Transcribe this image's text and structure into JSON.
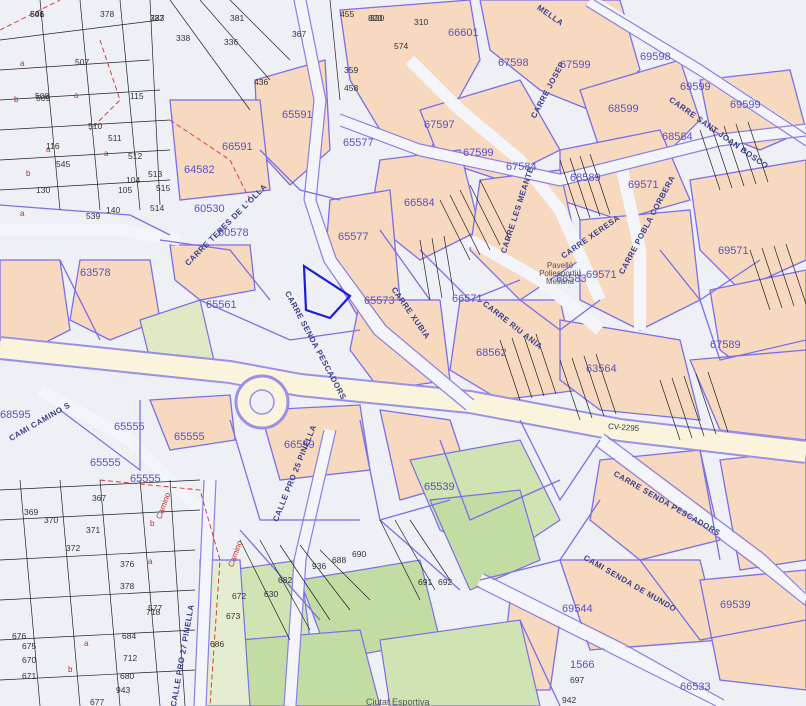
{
  "colors": {
    "background": "#eef0f6",
    "built": "#f6d9bf",
    "green": "#cfe3b3",
    "sports": "#c2dca3",
    "pale_green": "#e4edcf",
    "road": "#fbf4dc",
    "parcel_line": "#7b6ee6",
    "subparcel_line": "#222222",
    "boundary": "#d32f2f",
    "selection": "#1a1adb",
    "parcel_text": "#5a4fd0",
    "street_text": "#3a3f8a"
  },
  "selected_parcel": {
    "outline": "selection"
  },
  "parcel_labels": [
    {
      "id": "p1",
      "text": "66601"
    },
    {
      "id": "p2",
      "text": "67598"
    },
    {
      "id": "p3",
      "text": "67599"
    },
    {
      "id": "p4",
      "text": "69598"
    },
    {
      "id": "p5",
      "text": "69599"
    },
    {
      "id": "p6",
      "text": "69599"
    },
    {
      "id": "p7",
      "text": "68599"
    },
    {
      "id": "p8",
      "text": "67597"
    },
    {
      "id": "p9",
      "text": "65591"
    },
    {
      "id": "p10",
      "text": "66591"
    },
    {
      "id": "p11",
      "text": "64582"
    },
    {
      "id": "p12",
      "text": "65577"
    },
    {
      "id": "p13",
      "text": "67599"
    },
    {
      "id": "p14",
      "text": "67584"
    },
    {
      "id": "p15",
      "text": "68589"
    },
    {
      "id": "p16",
      "text": "69571"
    },
    {
      "id": "p17",
      "text": "68584"
    },
    {
      "id": "p18",
      "text": "66584"
    },
    {
      "id": "p19",
      "text": "60530"
    },
    {
      "id": "p20",
      "text": "60578"
    },
    {
      "id": "p21",
      "text": "65577"
    },
    {
      "id": "p22",
      "text": "63578"
    },
    {
      "id": "p23",
      "text": "65561"
    },
    {
      "id": "p24",
      "text": "65573"
    },
    {
      "id": "p25",
      "text": "66571"
    },
    {
      "id": "p26",
      "text": "68583"
    },
    {
      "id": "p27",
      "text": "69571"
    },
    {
      "id": "p28",
      "text": "69571"
    },
    {
      "id": "p29",
      "text": "67589"
    },
    {
      "id": "p30",
      "text": "68562"
    },
    {
      "id": "p31",
      "text": "63564"
    },
    {
      "id": "p32",
      "text": "65555"
    },
    {
      "id": "p33",
      "text": "65555"
    },
    {
      "id": "p34",
      "text": "65555"
    },
    {
      "id": "p35",
      "text": "65555"
    },
    {
      "id": "p36",
      "text": "66559"
    },
    {
      "id": "p37",
      "text": "65539"
    },
    {
      "id": "p38",
      "text": "69544"
    },
    {
      "id": "p39",
      "text": "69539"
    },
    {
      "id": "p40",
      "text": "66533"
    },
    {
      "id": "p41",
      "text": "1566"
    },
    {
      "id": "p42",
      "text": "68595"
    }
  ],
  "street_labels": [
    {
      "id": "s1",
      "text": "CARRE SENDA PESCADORS"
    },
    {
      "id": "s2",
      "text": "CARRE SENDA PESCADORS"
    },
    {
      "id": "s3",
      "text": "CARRE SANT JOAN BOSCO"
    },
    {
      "id": "s4",
      "text": "CARRE POBLA CORBERA"
    },
    {
      "id": "s5",
      "text": "CARRE LES MEANTE"
    },
    {
      "id": "s6",
      "text": "CARRE RIU ANIA"
    },
    {
      "id": "s7",
      "text": "CARRE XUBIA"
    },
    {
      "id": "s8",
      "text": "CARRE XERESA"
    },
    {
      "id": "s9",
      "text": "CAMI SENDA DE MUNDO"
    },
    {
      "id": "s10",
      "text": "CALLE PRO 25 PINELLA"
    },
    {
      "id": "s11",
      "text": "CALLE PRO 27 PINELLA"
    },
    {
      "id": "s12",
      "text": "CARRE TERES DE L'OLLA"
    },
    {
      "id": "s13",
      "text": "CAMI CAMINO S"
    },
    {
      "id": "s14",
      "text": "MELLA"
    },
    {
      "id": "s15",
      "text": "CARRE JOSEP"
    }
  ],
  "road_label": "CV-2295",
  "place_labels": [
    {
      "id": "pl1",
      "text": "Pavelló Poliesportiu Meliana"
    },
    {
      "id": "pl2",
      "text": "Ciutat Esportiva"
    }
  ],
  "subparcel_labels": [
    "506",
    "377",
    "378",
    "381",
    "320",
    "455",
    "820",
    "310",
    "508",
    "507",
    "338",
    "336",
    "367",
    "359",
    "458",
    "574",
    "509",
    "436",
    "510",
    "511",
    "512",
    "513",
    "514",
    "515",
    "105",
    "116",
    "545",
    "130",
    "539",
    "140",
    "115",
    "104",
    "369",
    "370",
    "367",
    "371",
    "372",
    "376",
    "378",
    "712",
    "684",
    "680",
    "943",
    "677",
    "676",
    "675",
    "670",
    "671",
    "672",
    "673",
    "686",
    "682",
    "936",
    "688",
    "690",
    "691",
    "692",
    "697",
    "942",
    "577",
    "718",
    "630",
    "641",
    "783"
  ],
  "red_labels": [
    "a",
    "b",
    "a",
    "a",
    "b",
    "a",
    "b",
    "a",
    "a",
    "b",
    "Camino",
    "Camino",
    "a"
  ]
}
